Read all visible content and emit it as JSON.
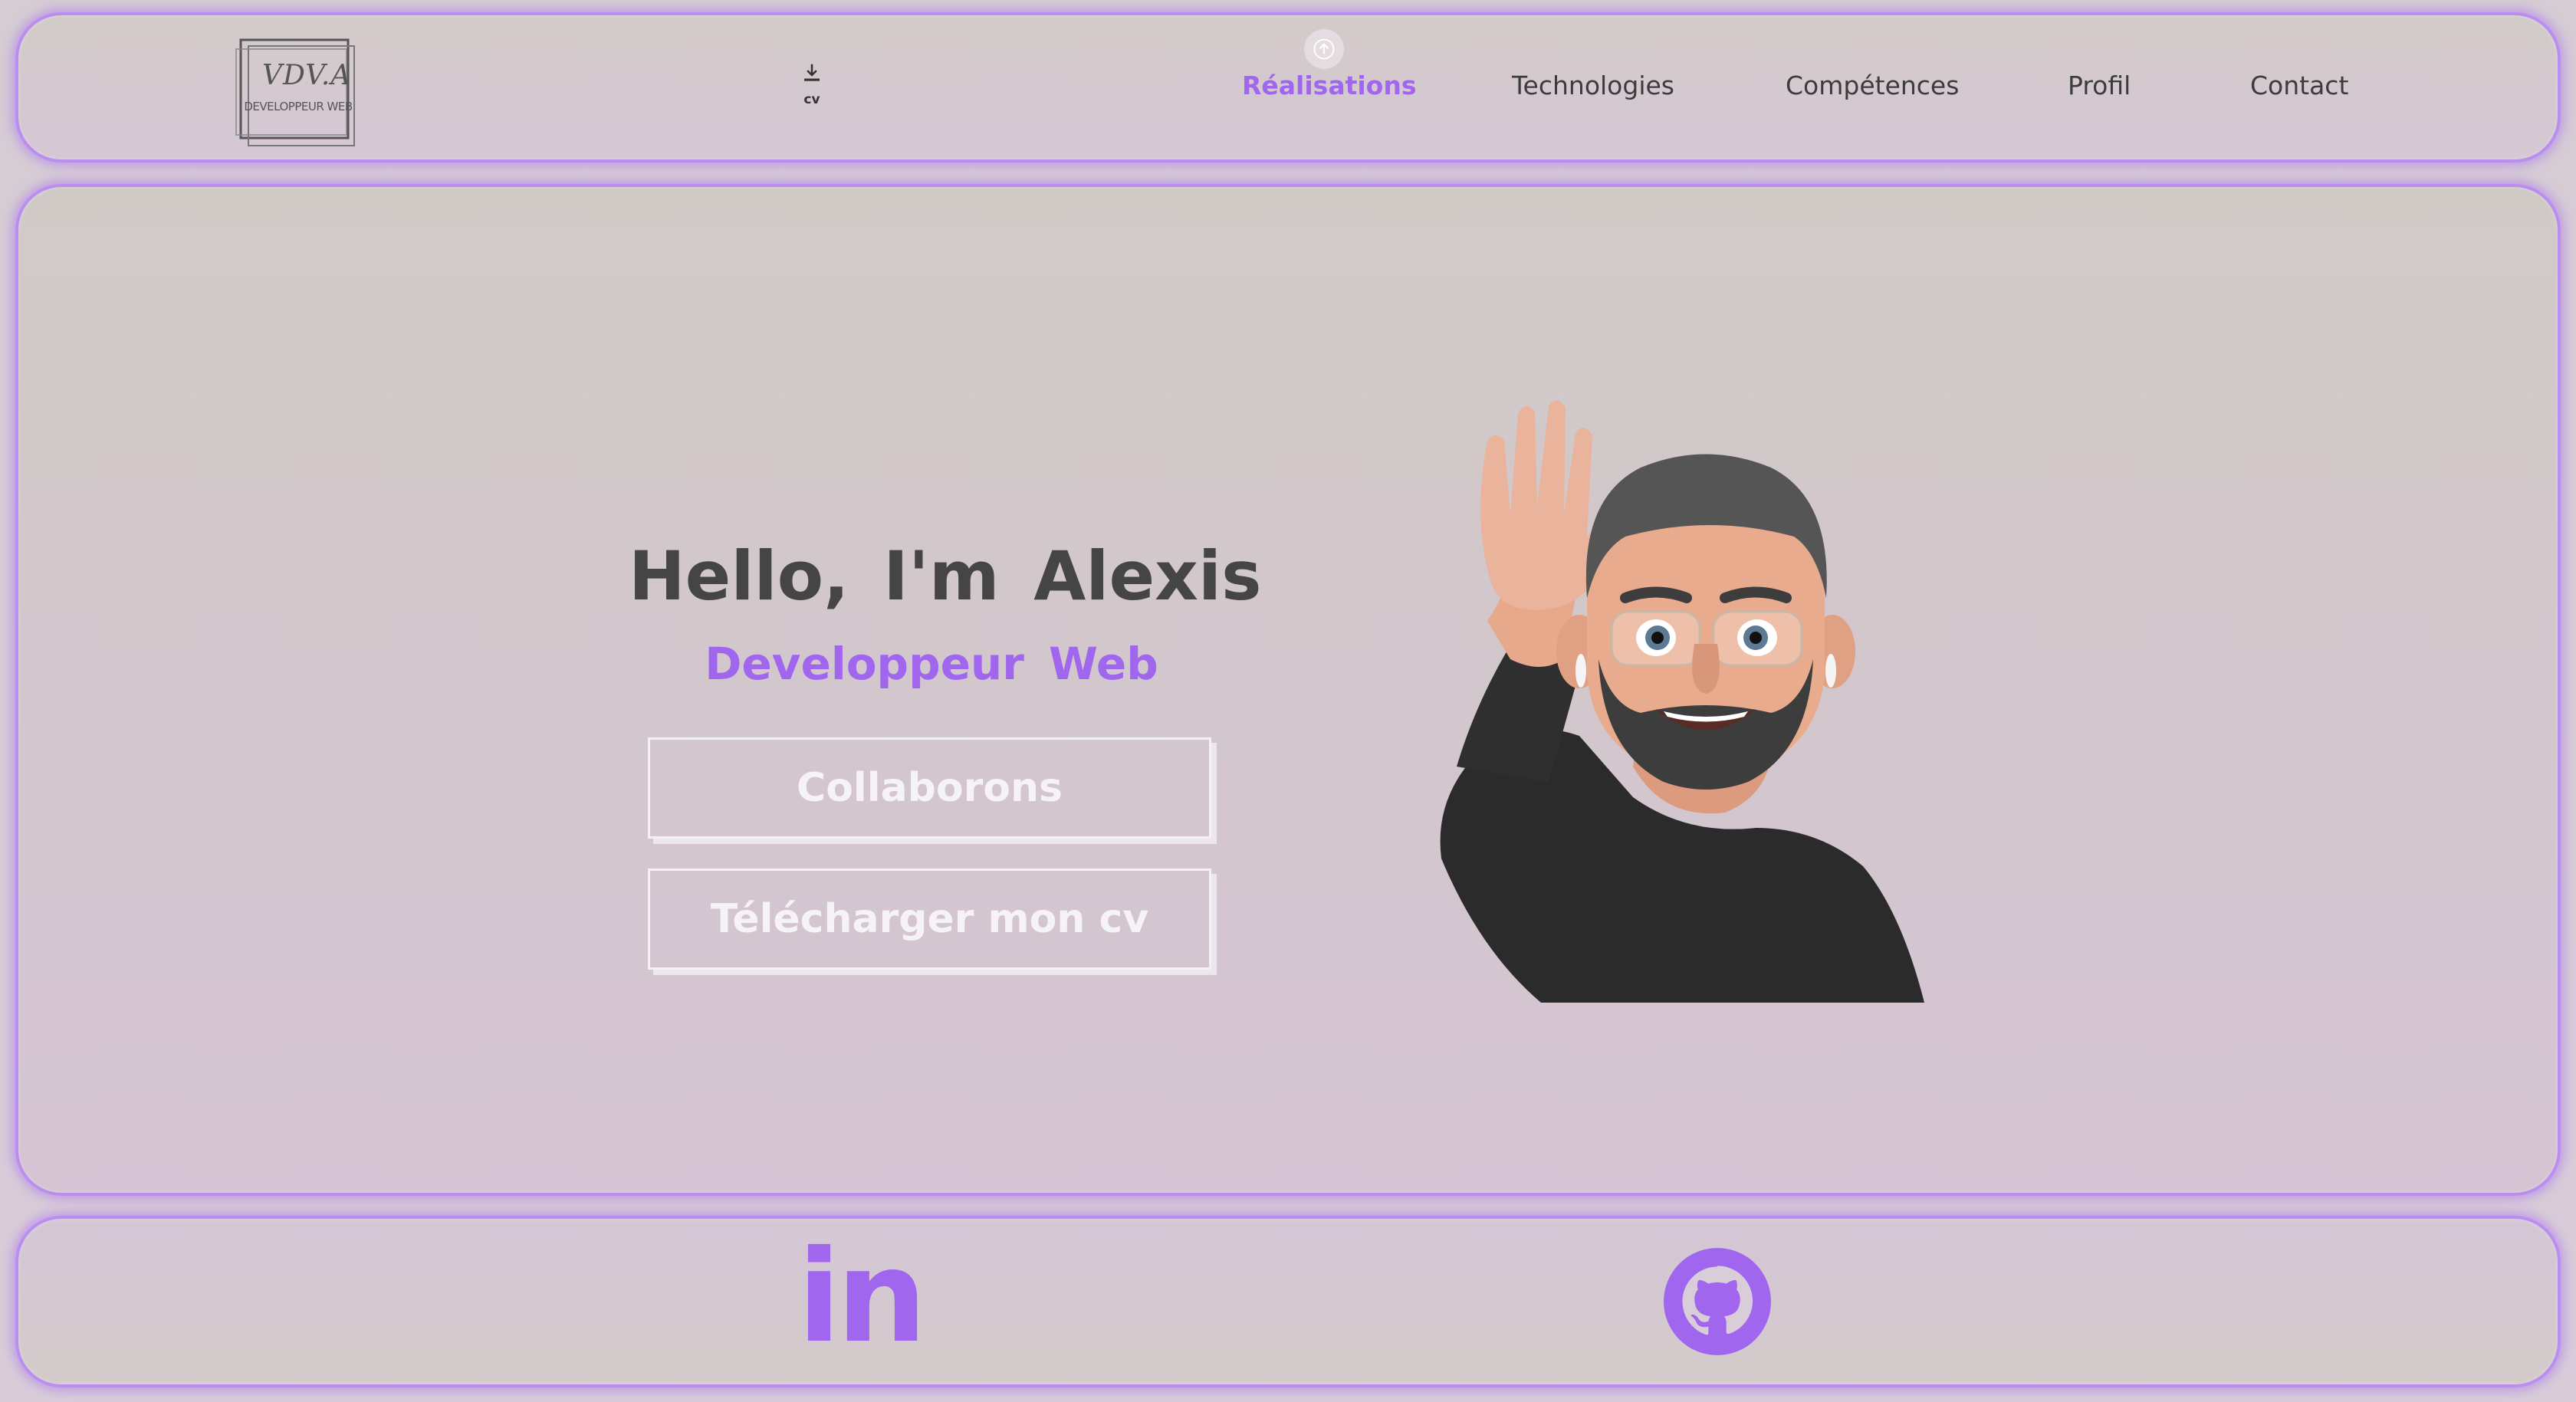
{
  "header": {
    "logo_mark": "VDV.A",
    "logo_sub": "DEVELOPPEUR WEB",
    "cv_label": "cv",
    "nav": [
      "Réalisations",
      "Technologies",
      "Compétences",
      "Profil",
      "Contact"
    ]
  },
  "hero": {
    "greeting": "Hello, I'm Alexis",
    "role": "Developpeur Web",
    "primary_button": "Collaborons",
    "secondary_button": "Télécharger mon cv"
  },
  "footer": {
    "linkedin_text": "in"
  },
  "colors": {
    "accent": "#a066ee",
    "text": "#454545"
  },
  "icons": [
    "download-icon",
    "arrow-up-icon",
    "linkedin-icon",
    "github-icon"
  ]
}
